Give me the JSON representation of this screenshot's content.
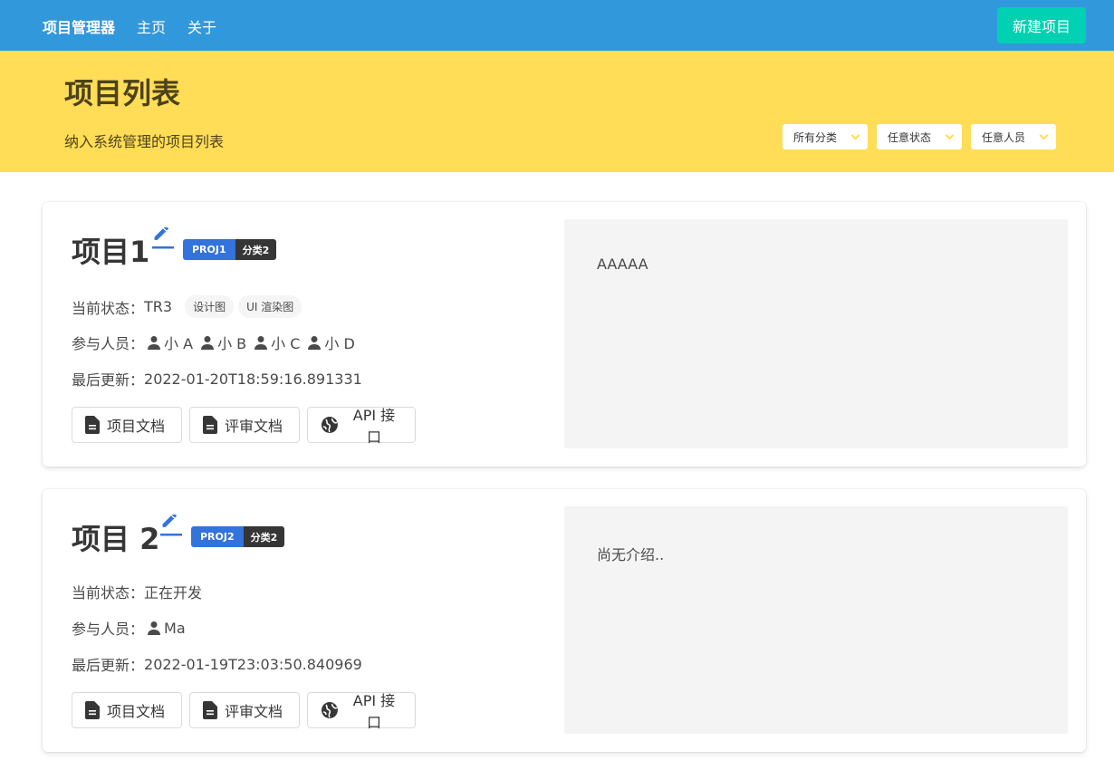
{
  "navbar": {
    "brand": "项目管理器",
    "links": [
      "主页",
      "关于"
    ],
    "new_button": "新建项目"
  },
  "hero": {
    "title": "项目列表",
    "subtitle": "纳入系统管理的项目列表",
    "filters": [
      "所有分类",
      "任意状态",
      "任意人员"
    ]
  },
  "labels": {
    "status": "当前状态：",
    "members": "参与人员：",
    "updated": "最后更新："
  },
  "projects": [
    {
      "name": "项目1",
      "code": "PROJ1",
      "category": "分类2",
      "status": "TR3",
      "status_tags": [
        "设计图",
        "UI 渲染图"
      ],
      "members": [
        "小 A",
        "小 B",
        "小 C",
        "小 D"
      ],
      "updated": "2022-01-20T18:59:16.891331",
      "buttons": [
        "项目文档",
        "评审文档",
        "API 接口"
      ],
      "description": "AAAAA"
    },
    {
      "name": "项目 2",
      "code": "PROJ2",
      "category": "分类2",
      "status": "正在开发",
      "status_tags": [],
      "members": [
        "Ma"
      ],
      "updated": "2022-01-19T23:03:50.840969",
      "buttons": [
        "项目文档",
        "评审文档",
        "API 接口"
      ],
      "description": "尚无介绍.."
    }
  ],
  "colors": {
    "navbar": "#3298dc",
    "hero": "#ffdd57",
    "primary_button": "#00d1b2",
    "tag_code": "#3273dc",
    "tag_category": "#363636",
    "edit_icon": "#3273dc"
  },
  "icons": {
    "edit": "pencil-icon",
    "member": "user-icon",
    "doc": "file-icon",
    "api": "globe-icon",
    "filter": "chevron-down-icon"
  }
}
